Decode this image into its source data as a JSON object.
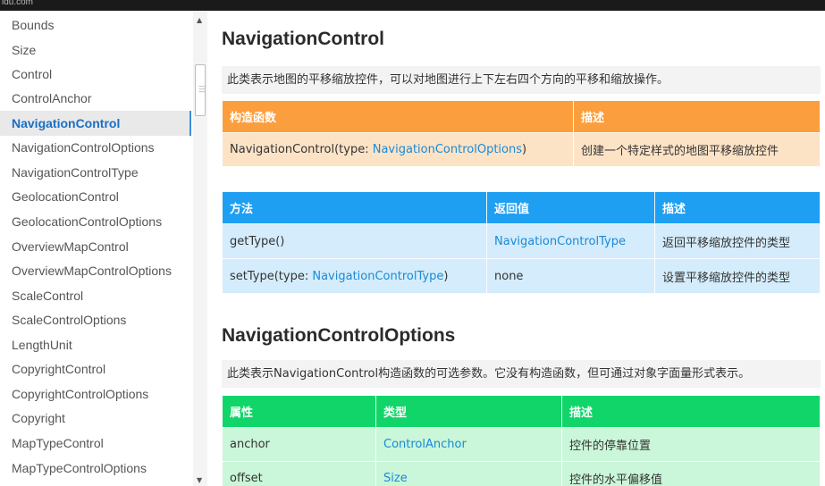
{
  "top_bar": {
    "url_fragment": "idu.com"
  },
  "sidebar": {
    "items": [
      {
        "label": "Bounds"
      },
      {
        "label": "Size"
      },
      {
        "label": "Control"
      },
      {
        "label": "ControlAnchor"
      },
      {
        "label": "NavigationControl",
        "active": true
      },
      {
        "label": "NavigationControlOptions"
      },
      {
        "label": "NavigationControlType"
      },
      {
        "label": "GeolocationControl"
      },
      {
        "label": "GeolocationControlOptions"
      },
      {
        "label": "OverviewMapControl"
      },
      {
        "label": "OverviewMapControlOptions"
      },
      {
        "label": "ScaleControl"
      },
      {
        "label": "ScaleControlOptions"
      },
      {
        "label": "LengthUnit"
      },
      {
        "label": "CopyrightControl"
      },
      {
        "label": "CopyrightControlOptions"
      },
      {
        "label": "Copyright"
      },
      {
        "label": "MapTypeControl"
      },
      {
        "label": "MapTypeControlOptions"
      }
    ]
  },
  "sections": {
    "nav": {
      "title": "NavigationControl",
      "description": "此类表示地图的平移缩放控件，可以对地图进行上下左右四个方向的平移和缩放操作。",
      "constructor_table": {
        "headers": [
          "构造函数",
          "描述"
        ],
        "row": {
          "name": "NavigationControl(type: ",
          "type_link": "NavigationControlOptions",
          "close": ")",
          "desc": "创建一个特定样式的地图平移缩放控件"
        }
      },
      "method_table": {
        "headers": [
          "方法",
          "返回值",
          "描述"
        ],
        "rows": [
          {
            "method": "getType()",
            "returns": "NavigationControlType",
            "desc": "返回平移缩放控件的类型"
          },
          {
            "method_prefix": "setType(type: ",
            "method_link": "NavigationControlType",
            "method_suffix": ")",
            "returns": "none",
            "desc": "设置平移缩放控件的类型"
          }
        ]
      }
    },
    "options": {
      "title": "NavigationControlOptions",
      "description": "此类表示NavigationControl构造函数的可选参数。它没有构造函数，但可通过对象字面量形式表示。",
      "prop_table": {
        "headers": [
          "属性",
          "类型",
          "描述"
        ],
        "rows": [
          {
            "prop": "anchor",
            "type": "ControlAnchor",
            "desc": "控件的停靠位置"
          },
          {
            "prop": "offset",
            "type": "Size",
            "desc": "控件的水平偏移值"
          }
        ]
      }
    }
  },
  "colors": {
    "orange_header": "#fb9e3d",
    "blue_header": "#1e9ff2",
    "green_header": "#12d56a",
    "link": "#1a8ad6",
    "active_nav": "#1a6fc4"
  }
}
